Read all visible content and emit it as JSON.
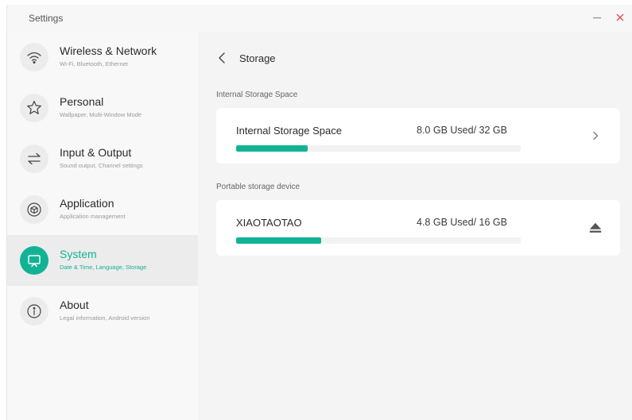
{
  "window": {
    "title": "Settings"
  },
  "sidebar": {
    "items": [
      {
        "label": "Wireless & Network",
        "sub": "Wi-Fi, Bluetooth, Ethernet",
        "icon": "wifi-icon"
      },
      {
        "label": "Personal",
        "sub": "Wallpaper, Multi-Window Mode",
        "icon": "star-icon"
      },
      {
        "label": "Input & Output",
        "sub": "Sound output, Channel settings",
        "icon": "swap-arrows-icon"
      },
      {
        "label": "Application",
        "sub": "Application management",
        "icon": "cube-icon"
      },
      {
        "label": "System",
        "sub": "Date & Time, Language, Storage",
        "icon": "monitor-icon",
        "active": true
      },
      {
        "label": "About",
        "sub": "Legal information, Android version",
        "icon": "info-icon"
      }
    ]
  },
  "main": {
    "title": "Storage",
    "sections": [
      {
        "label": "Internal Storage Space",
        "card": {
          "name": "Internal Storage Space",
          "usage": "8.0 GB Used/ 32 GB",
          "used_fraction": 0.25,
          "action_icon": "chevron-right-icon"
        }
      },
      {
        "label": "Portable storage device",
        "card": {
          "name": "XIAOTAOTAO",
          "usage": "4.8 GB Used/ 16 GB",
          "used_fraction": 0.3,
          "action_icon": "eject-icon"
        }
      }
    ]
  },
  "colors": {
    "accent": "#12b394",
    "close": "#e84b4b"
  }
}
